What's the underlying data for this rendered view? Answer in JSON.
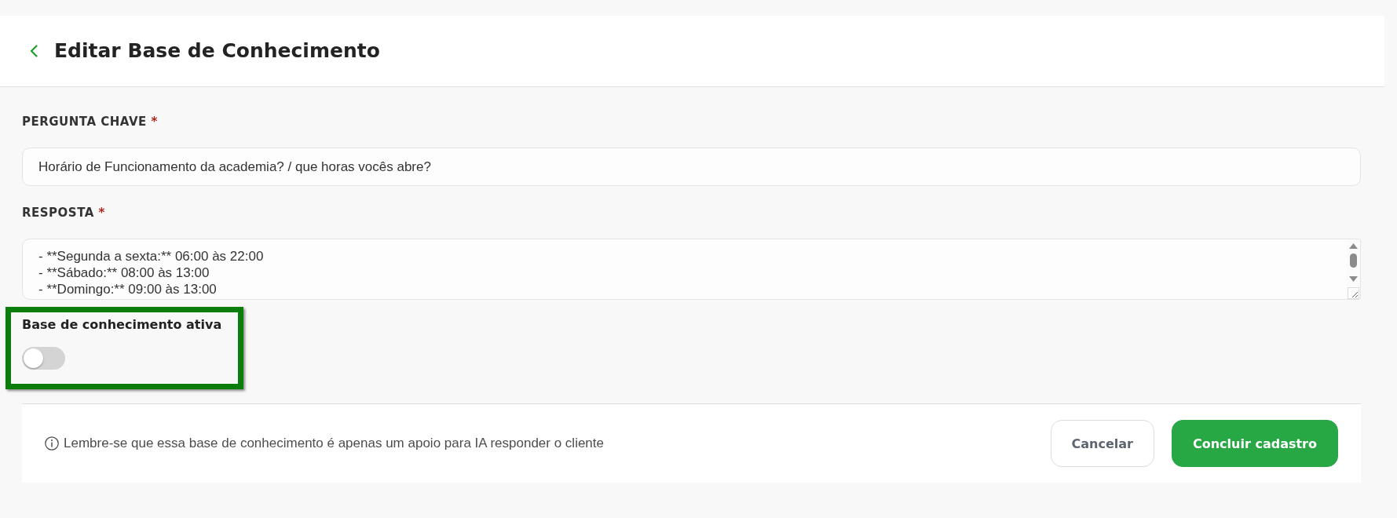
{
  "header": {
    "title": "Editar Base de Conhecimento"
  },
  "fields": [
    {
      "kind": "text",
      "label": "PERGUNTA CHAVE",
      "required_mark": "*",
      "value": "Horário de Funcionamento da academia? / que horas vocês abre?"
    },
    {
      "kind": "textarea",
      "label": "RESPOSTA",
      "required_mark": "*",
      "value": "- **Segunda a sexta:** 06:00 às 22:00\n- **Sábado:** 08:00 às 13:00\n- **Domingo:** 09:00 às 13:00"
    }
  ],
  "toggle": {
    "label": "Base de conhecimento ativa",
    "on": false,
    "highlighted": true
  },
  "footer": {
    "note": "Lembre-se que essa base de conhecimento é apenas um apoio para IA responder o cliente",
    "buttons": [
      {
        "kind": "secondary",
        "label": "Cancelar"
      },
      {
        "kind": "primary",
        "label": "Concluir cadastro"
      }
    ]
  }
}
